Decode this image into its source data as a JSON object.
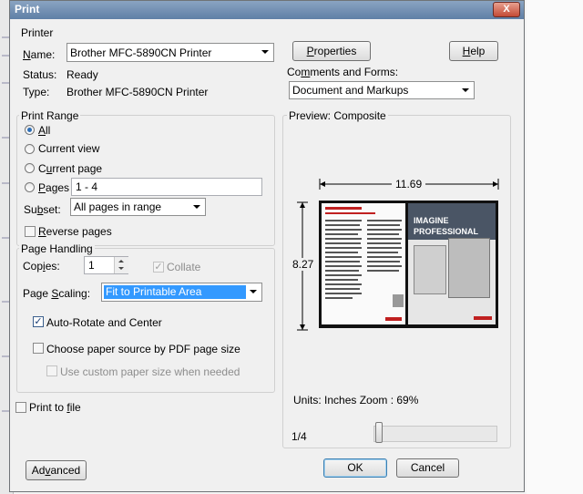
{
  "window": {
    "title": "Print",
    "close_label": "X"
  },
  "printer": {
    "group_label": "Printer",
    "name_label": "Name:",
    "name_value": "Brother MFC-5890CN Printer",
    "status_label": "Status:",
    "status_value": "Ready",
    "type_label": "Type:",
    "type_value": "Brother MFC-5890CN Printer",
    "properties_button": "Properties",
    "help_button": "Help",
    "comments_label": "Comments and Forms:",
    "comments_value": "Document and Markups"
  },
  "print_range": {
    "group_label": "Print Range",
    "options": [
      "All",
      "Current view",
      "Current page",
      "Pages"
    ],
    "selected": "All",
    "pages_value": "1 - 4",
    "subset_label": "Subset:",
    "subset_value": "All pages in range",
    "reverse_label": "Reverse pages"
  },
  "page_handling": {
    "group_label": "Page Handling",
    "copies_label": "Copies:",
    "copies_value": "1",
    "collate_label": "Collate",
    "scaling_label": "Page Scaling:",
    "scaling_value": "Fit to Printable Area",
    "auto_rotate_label": "Auto-Rotate and Center",
    "paper_source_label": "Choose paper source by PDF page size",
    "custom_paper_label": "Use custom paper size when needed"
  },
  "print_to_file_label": "Print to file",
  "preview": {
    "title": "Preview: Composite",
    "width_value": "11.69",
    "height_value": "8.27",
    "units_zoom": "Units: Inches Zoom :  69%",
    "page_indicator": "1/4",
    "page_fraction": 0.25,
    "thumb_heading": "IMAGINE",
    "thumb_subheading": "PROFESSIONAL"
  },
  "buttons": {
    "advanced": "Advanced",
    "ok": "OK",
    "cancel": "Cancel"
  }
}
